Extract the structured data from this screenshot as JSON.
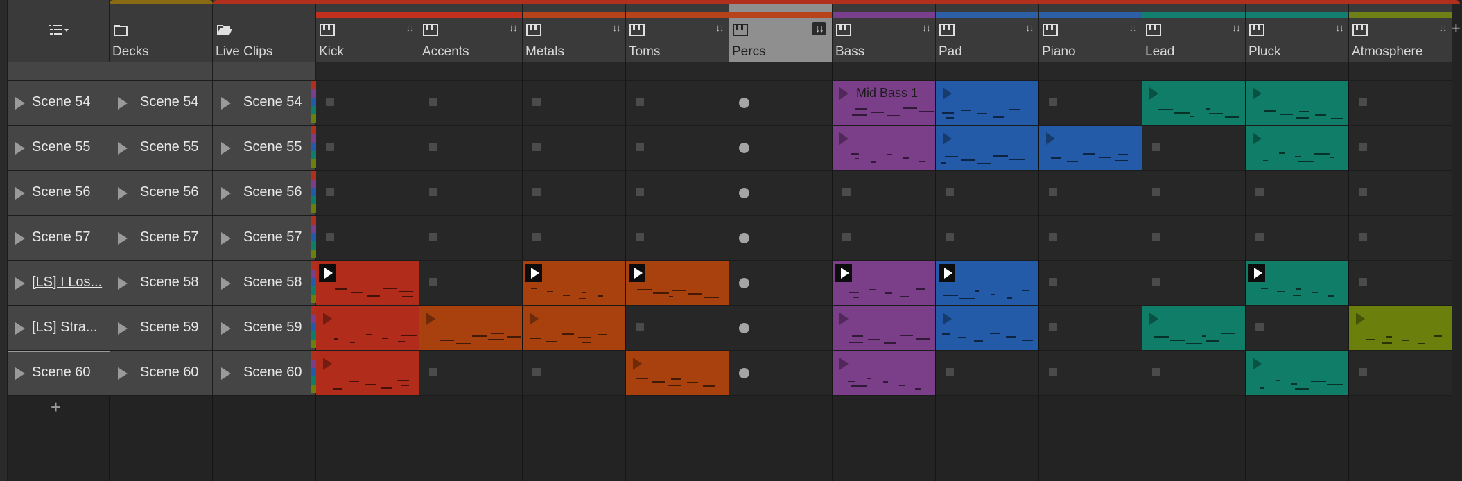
{
  "header": {
    "menu_icon": "list-menu-icon",
    "groups": [
      {
        "name": "Decks",
        "icon": "folder-closed-icon",
        "color": "#8a6b14"
      },
      {
        "name": "Live Clips",
        "icon": "folder-open-icon",
        "color": "#b02f1d"
      }
    ],
    "tracks": [
      {
        "name": "Kick",
        "icon": "piano-icon",
        "color": "#c0301c"
      },
      {
        "name": "Accents",
        "icon": "piano-icon",
        "color": "#c0301c"
      },
      {
        "name": "Metals",
        "icon": "piano-icon",
        "color": "#b6431a"
      },
      {
        "name": "Toms",
        "icon": "piano-icon",
        "color": "#b6431a"
      },
      {
        "name": "Percs",
        "icon": "piano-icon",
        "color": "#b6431a",
        "selected": true
      },
      {
        "name": "Bass",
        "icon": "piano-icon",
        "color": "#7a3f8c"
      },
      {
        "name": "Pad",
        "icon": "piano-icon",
        "color": "#2d5fa6"
      },
      {
        "name": "Piano",
        "icon": "piano-icon",
        "color": "#2d5fa6"
      },
      {
        "name": "Lead",
        "icon": "piano-icon",
        "color": "#13806f"
      },
      {
        "name": "Pluck",
        "icon": "piano-icon",
        "color": "#13806f"
      },
      {
        "name": "Atmosphere",
        "icon": "piano-icon",
        "color": "#6e8016"
      }
    ],
    "arrow_glyph": "↓↓",
    "add_glyph": "+"
  },
  "scenes": [
    {
      "col1": "Scene 54",
      "decks": "Scene 54",
      "live": "Scene 54"
    },
    {
      "col1": "Scene 55",
      "decks": "Scene 55",
      "live": "Scene 55"
    },
    {
      "col1": "Scene 56",
      "decks": "Scene 56",
      "live": "Scene 56"
    },
    {
      "col1": "Scene 57",
      "decks": "Scene 57",
      "live": "Scene 57"
    },
    {
      "col1": "[LS] I Los...",
      "decks": "Scene 58",
      "live": "Scene 58"
    },
    {
      "col1": "[LS] Stra...",
      "decks": "Scene 59",
      "live": "Scene 59"
    },
    {
      "col1": "Scene 60",
      "decks": "Scene 60",
      "live": "Scene 60"
    }
  ],
  "add_scene": "+",
  "clips": {
    "bass_row0_name": "Mid Bass 1"
  },
  "colors": {
    "red": "#b22c1b",
    "orange": "#a9410f",
    "purple": "#7b3f8a",
    "blue": "#235ba8",
    "teal": "#0f7d68",
    "olive": "#6a7f0c"
  }
}
